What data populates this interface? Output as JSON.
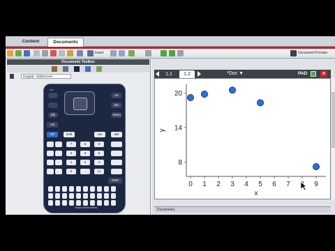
{
  "tabs": [
    {
      "label": "Content"
    },
    {
      "label": "Documents"
    }
  ],
  "toolbar": {
    "insert_label": "Insert",
    "doc_preview_label": "Document Preview"
  },
  "left_panel": {
    "title": "Documents Toolbox",
    "keypad_select": "Keypad - SideScreen"
  },
  "calculator": {
    "brand": "Texas Instruments",
    "keys_row1": [
      "ctrl",
      "shift",
      "var",
      "del"
    ],
    "digits": [
      "7",
      "8",
      "9",
      "4",
      "5",
      "6",
      "1",
      "2",
      "3",
      "0",
      ".",
      "(-)"
    ],
    "enter_label": "enter",
    "esc_label": "esc",
    "doc_label": "doc",
    "menu_label": "menu",
    "tab_label": "tab",
    "cat_label": "cat",
    "on_label": "on"
  },
  "document": {
    "tabs": [
      "1.1",
      "1.2"
    ],
    "active_tab": "1.2",
    "title": "*Doc",
    "pad_label": "PAD",
    "status_tab": "Document1"
  },
  "chart_data": {
    "type": "scatter",
    "xlabel": "x",
    "ylabel": "y",
    "x_ticks": [
      "0",
      "1",
      "2",
      "3",
      "4",
      "5",
      "6",
      "7",
      "8",
      "9"
    ],
    "y_ticks": [
      "8",
      "14",
      "20"
    ],
    "xlim": [
      -0.3,
      9.7
    ],
    "ylim": [
      5.5,
      21.5
    ],
    "points": [
      {
        "x": 0,
        "y": 19.2
      },
      {
        "x": 1,
        "y": 19.8
      },
      {
        "x": 3,
        "y": 20.5
      },
      {
        "x": 5,
        "y": 18.3
      },
      {
        "x": 9,
        "y": 7.2
      }
    ],
    "point_color": "#2a6fdb"
  }
}
